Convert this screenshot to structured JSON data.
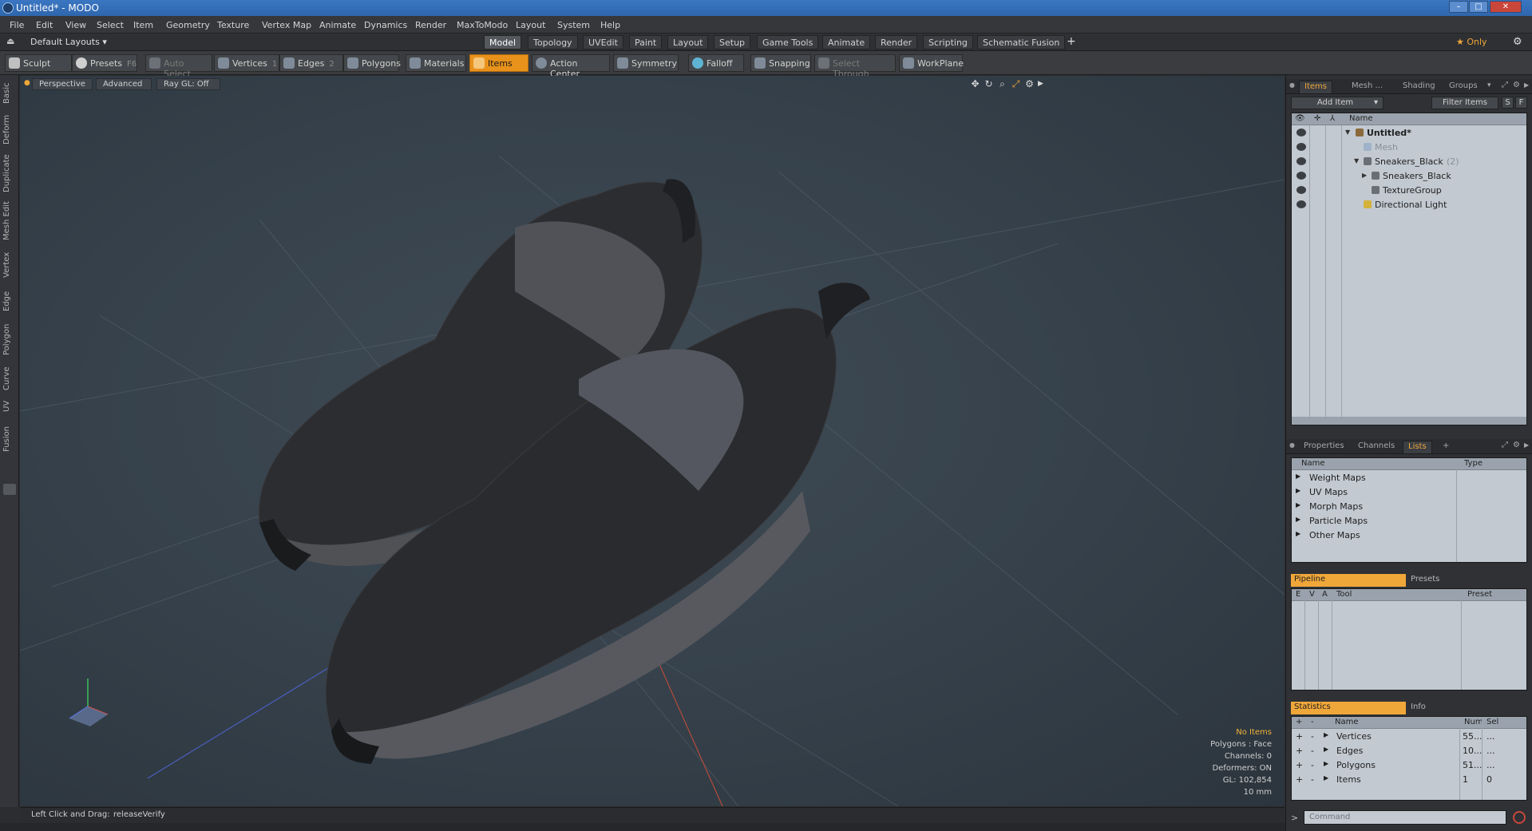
{
  "window": {
    "title": "Untitled* - MODO",
    "min": "–",
    "max": "□",
    "close": "✕"
  },
  "menu": [
    "File",
    "Edit",
    "View",
    "Select",
    "Item",
    "Geometry",
    "Texture",
    "Vertex Map",
    "Animate",
    "Dynamics",
    "Render",
    "MaxToModo",
    "Layout",
    "System",
    "Help"
  ],
  "layoutbar": {
    "layouts_label": "Default Layouts",
    "tabs": [
      "Model",
      "Topology",
      "UVEdit",
      "Paint",
      "Layout",
      "Setup",
      "Game Tools",
      "Animate",
      "Render",
      "Scripting",
      "Schematic Fusion"
    ],
    "active_tab": "Model",
    "add": "+",
    "only_label": "★ Only"
  },
  "toolbar": {
    "sculpt": "Sculpt",
    "presets": "Presets",
    "presets_key": "F6",
    "auto_select": "Auto Select",
    "vertices": "Vertices",
    "vertices_key": "1",
    "edges": "Edges",
    "edges_key": "2",
    "polygons": "Polygons",
    "materials": "Materials",
    "items": "Items",
    "action_center": "Action Center",
    "symmetry": "Symmetry",
    "falloff": "Falloff",
    "snapping": "Snapping",
    "select_through": "Select Through",
    "workplane": "WorkPlane"
  },
  "left_tabs": [
    "Basic",
    "Deform",
    "Duplicate",
    "Mesh Edit",
    "Vertex",
    "Edge",
    "Polygon",
    "Curve",
    "UV",
    "Fusion"
  ],
  "viewport": {
    "perspective": "Perspective",
    "advanced": "Advanced",
    "raygl": "Ray GL: Off",
    "info": {
      "no_items": "No Items",
      "polygons": "Polygons : Face",
      "channels": "Channels: 0",
      "deformers": "Deformers: ON",
      "gl": "GL: 102,854",
      "scale": "10 mm"
    }
  },
  "status": {
    "hint_label": "Left Click and Drag:",
    "hint_value": "releaseVerify"
  },
  "items_panel": {
    "tabs": [
      "Items",
      "Mesh ...",
      "Shading",
      "Groups"
    ],
    "active_tab": "Items",
    "add_item": "Add Item",
    "filter_items": "Filter Items",
    "s_btn": "S",
    "f_btn": "F",
    "col_name": "Name",
    "tree": [
      {
        "label": "Untitled*",
        "depth": 0,
        "style": "bold"
      },
      {
        "label": "Mesh",
        "depth": 1,
        "style": "dim"
      },
      {
        "label": "Sneakers_Black",
        "depth": 1,
        "style": "normal",
        "suffix": "(2)"
      },
      {
        "label": "Sneakers_Black",
        "depth": 2,
        "style": "normal"
      },
      {
        "label": "TextureGroup",
        "depth": 2,
        "style": "normal"
      },
      {
        "label": "Directional Light",
        "depth": 1,
        "style": "normal"
      }
    ]
  },
  "lists_panel": {
    "tabs": [
      "Properties",
      "Channels",
      "Lists"
    ],
    "active_tab": "Lists",
    "add": "+",
    "col_name": "Name",
    "col_type": "Type",
    "rows": [
      "Weight Maps",
      "UV Maps",
      "Morph Maps",
      "Particle Maps",
      "Other Maps"
    ]
  },
  "pipeline_panel": {
    "tabs": [
      "Pipeline",
      "Presets"
    ],
    "cols": [
      "E",
      "V",
      "A",
      "Tool",
      "Preset"
    ]
  },
  "stats_panel": {
    "tabs": [
      "Statistics",
      "Info"
    ],
    "cols": [
      "+",
      "-",
      "Name",
      "Num",
      "Sel"
    ],
    "rows": [
      {
        "name": "Vertices",
        "num": "55...",
        "sel": "..."
      },
      {
        "name": "Edges",
        "num": "10...",
        "sel": "..."
      },
      {
        "name": "Polygons",
        "num": "51...",
        "sel": "..."
      },
      {
        "name": "Items",
        "num": "1",
        "sel": "0"
      }
    ]
  },
  "command": {
    "prompt": ">",
    "placeholder": "Command"
  },
  "colors": {
    "accent": "#f0a73a",
    "items_highlight": "#e8921c",
    "titlebar": "#3a76c2"
  }
}
